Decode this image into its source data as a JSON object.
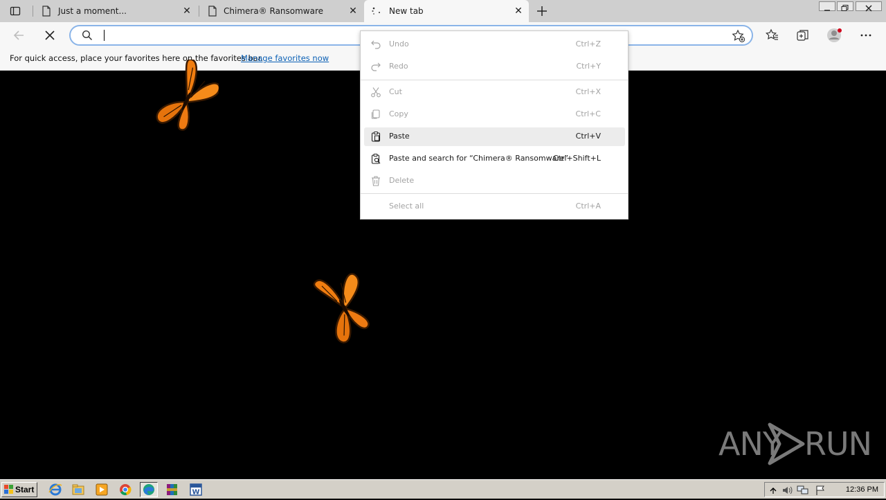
{
  "browser": {
    "tabs": [
      {
        "title": "Just a moment...",
        "active": false
      },
      {
        "title": "Chimera® Ransomware",
        "active": false
      },
      {
        "title": "New tab",
        "active": true
      }
    ],
    "address_value": "",
    "favorites_bar": {
      "message": "For quick access, place your favorites here on the favorites bar.",
      "link": "Manage favorites now"
    }
  },
  "context_menu": {
    "items": [
      {
        "label": "Undo",
        "shortcut": "Ctrl+Z",
        "enabled": false,
        "icon": "undo-icon"
      },
      {
        "label": "Redo",
        "shortcut": "Ctrl+Y",
        "enabled": false,
        "icon": "redo-icon"
      },
      {
        "label": "Cut",
        "shortcut": "Ctrl+X",
        "enabled": false,
        "icon": "scissors-icon"
      },
      {
        "label": "Copy",
        "shortcut": "Ctrl+C",
        "enabled": false,
        "icon": "copy-icon"
      },
      {
        "label": "Paste",
        "shortcut": "Ctrl+V",
        "enabled": true,
        "highlighted": true,
        "icon": "clipboard-icon"
      },
      {
        "label": "Paste and search for “Chimera® Ransomware”",
        "shortcut": "Ctrl+Shift+L",
        "enabled": true,
        "icon": "clipboard-search-icon"
      },
      {
        "label": "Delete",
        "shortcut": "",
        "enabled": false,
        "icon": "trash-icon"
      },
      {
        "label": "Select all",
        "shortcut": "Ctrl+A",
        "enabled": false
      }
    ]
  },
  "watermark": {
    "left": "ANY",
    "right": "RUN"
  },
  "taskbar": {
    "start_label": "Start",
    "clock": "12:36 PM"
  },
  "colors": {
    "page_background": "#000000",
    "butterfly_orange": "#f07d10",
    "address_focus": "#8ab4e8",
    "link": "#0b60b5"
  }
}
